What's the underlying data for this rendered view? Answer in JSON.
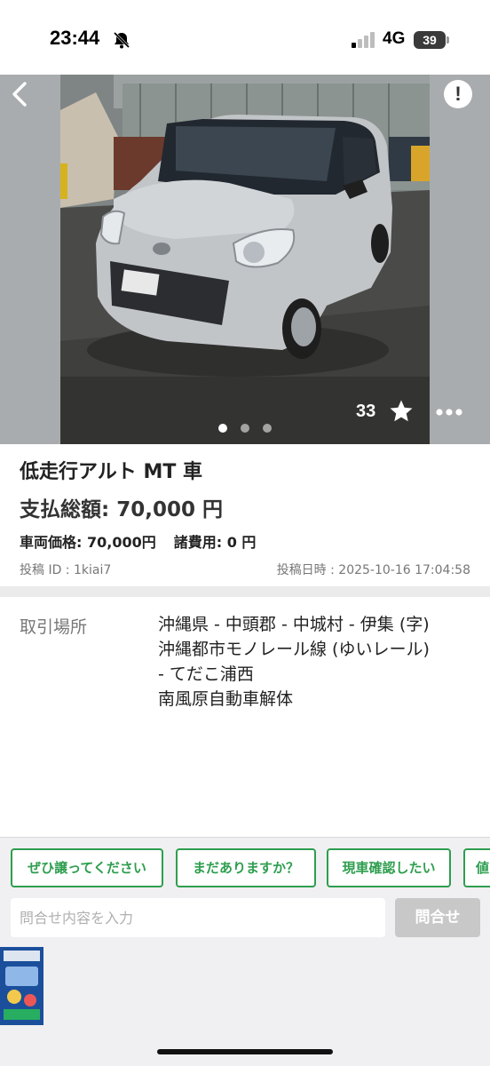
{
  "status_bar": {
    "time": "23:44",
    "network": "4G",
    "battery": "39"
  },
  "listing": {
    "favorite_count": "33",
    "title": "低走行アルト MT 車",
    "total_price": "支払総額: 70,000 円",
    "vehicle_price": "車両価格: 70,000円",
    "misc_fees": "諸費用: 0 円",
    "post_id": "投稿 ID : 1kiai7",
    "post_date": "投稿日時 : 2025-10-16 17:04:58"
  },
  "location": {
    "label": "取引場所",
    "lines": [
      "沖縄県 - 中頭郡 - 中城村 - 伊集 (字)",
      "沖縄都市モノレール線 (ゆいレール)",
      "- てだこ浦西",
      "南風原自動車解体"
    ]
  },
  "quick_replies": [
    "ぜひ譲ってください",
    "まだありますか？",
    "現車確認したい",
    "値"
  ],
  "message": {
    "placeholder": "問合せ内容を入力",
    "send_label": "問合せ"
  },
  "colors": {
    "accent_green": "#2e9e4f",
    "send_disabled": "#c8c8c8"
  },
  "icons": [
    "back-arrow-icon",
    "alert-icon",
    "star-icon",
    "more-icon",
    "bell-off-icon",
    "signal-icon"
  ]
}
